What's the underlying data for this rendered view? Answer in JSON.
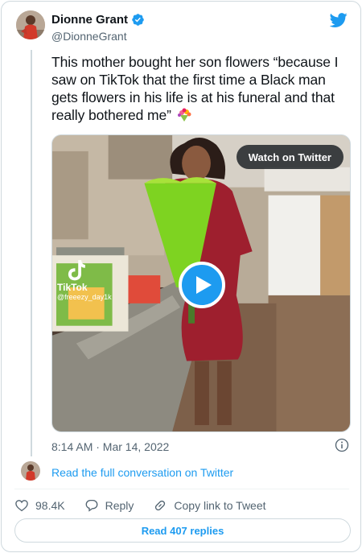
{
  "author": {
    "display_name": "Dionne Grant",
    "handle": "@DionneGrant",
    "verified_icon": "verified-badge-icon"
  },
  "brand_icon": "twitter-bird-icon",
  "tweet": {
    "text": "This mother bought her son flowers “because I saw on TikTok that the first time a Black man gets flowers in his life is at his funeral and that really bothered me”",
    "emoji": "bouquet"
  },
  "media": {
    "watch_label": "Watch on Twitter",
    "tiktok_brand": "TikTok",
    "tiktok_user": "@freeezy_day1k",
    "play_icon": "play-icon"
  },
  "meta": {
    "timestamp": "8:14 AM · Mar 14, 2022",
    "info_icon": "info-icon"
  },
  "conversation": {
    "link_text": "Read the full conversation on Twitter"
  },
  "actions": {
    "like_count": "98.4K",
    "reply_label": "Reply",
    "copy_label": "Copy link to Tweet"
  },
  "read_replies": "Read 407 replies",
  "colors": {
    "accent": "#1d9bf0",
    "text": "#0f1419",
    "secondary": "#536471",
    "border": "#cfd9de"
  }
}
